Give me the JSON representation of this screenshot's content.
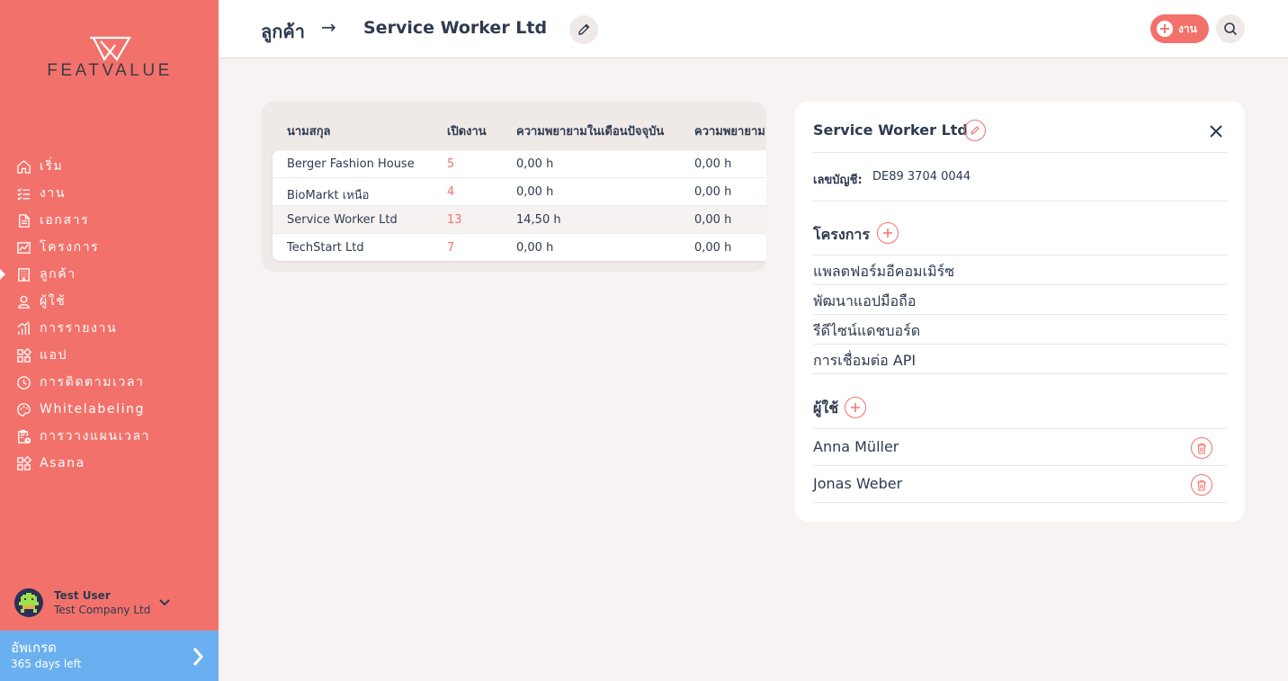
{
  "app": {
    "logo_text": "FEATVALUE",
    "brand_color": "#f2726b",
    "upgrade_color": "#6ab0f0"
  },
  "sidebar": {
    "items": [
      {
        "label": "เริ่ม",
        "icon": "home-icon",
        "active": false
      },
      {
        "label": "งาน",
        "icon": "task-list-icon",
        "active": false
      },
      {
        "label": "เอกสาร",
        "icon": "document-icon",
        "active": false
      },
      {
        "label": "โครงการ",
        "icon": "chart-board-icon",
        "active": false
      },
      {
        "label": "ลูกค้า",
        "icon": "building-icon",
        "active": true
      },
      {
        "label": "ผู้ใช้",
        "icon": "user-icon",
        "active": false
      },
      {
        "label": "การรายงาน",
        "icon": "bar-chart-icon",
        "active": false
      },
      {
        "label": "แอป",
        "icon": "apps-icon",
        "active": false
      },
      {
        "label": "การติดตามเวลา",
        "icon": "timer-icon",
        "active": false
      },
      {
        "label": "Whitelabeling",
        "icon": "palette-icon",
        "active": false
      },
      {
        "label": "การวางแผนเวลา",
        "icon": "clipboard-clock-icon",
        "active": false
      },
      {
        "label": "Asana",
        "icon": "apps-icon",
        "active": false
      }
    ],
    "user": {
      "name": "Test User",
      "company": "Test Company Ltd"
    },
    "upgrade": {
      "title": "อัพเกรด",
      "subtitle": "365 days left"
    }
  },
  "header": {
    "breadcrumb_root": "ลูกค้า",
    "breadcrumb_arrow": "→",
    "breadcrumb_current": "Service Worker Ltd",
    "task_button_label": "งาน"
  },
  "table": {
    "columns": [
      "นามสกุล",
      "เปิดงาน",
      "ความพยายามในเดือนปัจจุบัน",
      "ความพยายาม"
    ],
    "rows": [
      {
        "name": "Berger Fashion House",
        "open": "5",
        "current": "0,00 h",
        "total": "0,00 h",
        "highlight": false
      },
      {
        "name": "BioMarkt เหนือ",
        "open": "4",
        "current": "0,00 h",
        "total": "0,00 h",
        "highlight": false
      },
      {
        "name": "Service Worker Ltd",
        "open": "13",
        "current": "14,50 h",
        "total": "0,00 h",
        "highlight": true
      },
      {
        "name": "TechStart Ltd",
        "open": "7",
        "current": "0,00 h",
        "total": "0,00 h",
        "highlight": false
      }
    ]
  },
  "detail": {
    "title": "Service Worker Ltd",
    "account_label": "เลขบัญชี:",
    "account_value": "DE89 3704 0044",
    "projects_title": "โครงการ",
    "projects": [
      "แพลตฟอร์มอีคอมเมิร์ซ",
      "พัฒนาแอปมือถือ",
      "รีดีไซน์แดชบอร์ด",
      "การเชื่อมต่อ API"
    ],
    "users_title": "ผู้ใช้",
    "users": [
      "Anna Müller",
      "Jonas Weber"
    ]
  }
}
